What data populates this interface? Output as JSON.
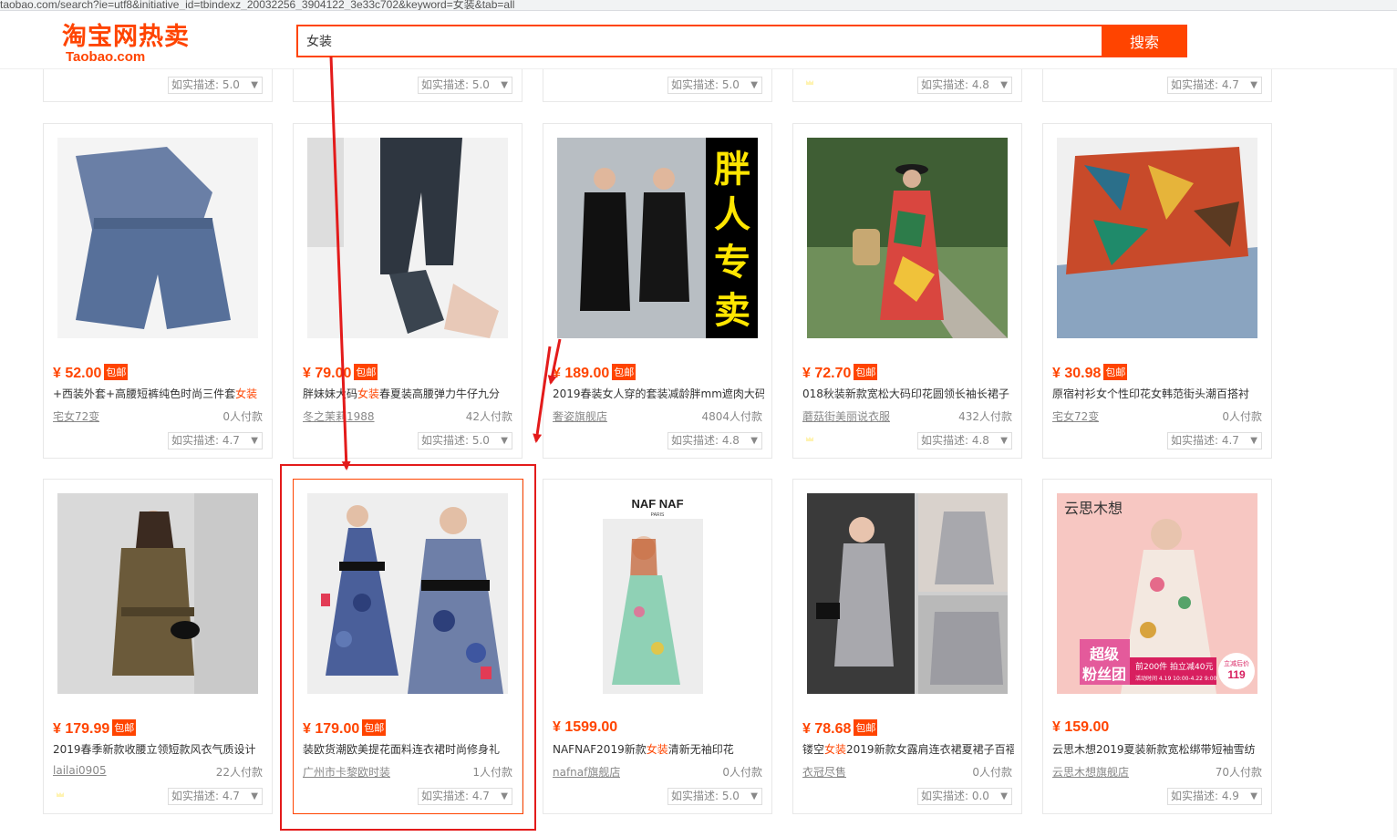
{
  "browser": {
    "url": "taobao.com/search?ie=utf8&initiative_id=tbindexz_20032256_3904122_3e33c702&keyword=女装&tab=all"
  },
  "header": {
    "logo_cn": "淘宝网热卖",
    "logo_en": "Taobao.com",
    "search_value": "女装",
    "search_button": "搜索",
    "accent_color": "#ff4400"
  },
  "rating_caret": "▼",
  "top_row": [
    {
      "icon": "tmall-icon",
      "rating": "如实描述: 5.0"
    },
    {
      "icon": "",
      "rating": "如实描述: 5.0"
    },
    {
      "icon": "",
      "rating": "如实描述: 5.0"
    },
    {
      "icon": "crown-icon",
      "rating": "如实描述: 4.8"
    },
    {
      "icon": "",
      "rating": "如实描述: 4.7"
    }
  ],
  "products": [
    {
      "price": "¥ 52.00",
      "badge": "包邮",
      "title_pre": "+西装外套+高腰短裤纯色时尚三件套",
      "title_kw": "女装",
      "title_post": "",
      "shop": "宅女72变",
      "sales": "0人付款",
      "icon": "",
      "rating": "如实描述: 4.7"
    },
    {
      "price": "¥ 79.00",
      "badge": "包邮",
      "title_pre": "胖妹妹大码",
      "title_kw": "女装",
      "title_post": "春夏装高腰弹力牛仔九分",
      "shop": "冬之茉莉1988",
      "sales": "42人付款",
      "icon": "",
      "rating": "如实描述: 5.0"
    },
    {
      "price": "¥ 189.00",
      "badge": "包邮",
      "title_pre": "2019春装女人穿的套装减龄胖mm遮肉大码",
      "title_kw": "",
      "title_post": "",
      "shop": "奢姿旗舰店",
      "sales": "4804人付款",
      "icon": "tmall-icon",
      "rating": "如实描述: 4.8"
    },
    {
      "price": "¥ 72.70",
      "badge": "包邮",
      "title_pre": "018秋装新款宽松大码印花圆领长袖长裙子",
      "title_kw": "",
      "title_post": "",
      "shop": "蘑菇街美丽说衣服",
      "sales": "432人付款",
      "icon": "crown-icon",
      "rating": "如实描述: 4.8"
    },
    {
      "price": "¥ 30.98",
      "badge": "包邮",
      "title_pre": "原宿衬衫女个性印花女韩范街头潮百搭衬",
      "title_kw": "",
      "title_post": "",
      "shop": "宅女72变",
      "sales": "0人付款",
      "icon": "",
      "rating": "如实描述: 4.7"
    },
    {
      "price": "¥ 179.99",
      "badge": "包邮",
      "title_pre": "2019春季新款收腰立领短款风衣气质设计",
      "title_kw": "",
      "title_post": "",
      "shop": "lailai0905",
      "sales": "22人付款",
      "icon": "crown-icon",
      "rating": "如实描述: 4.7"
    },
    {
      "price": "¥ 179.00",
      "badge": "包邮",
      "title_pre": "装欧货潮欧美提花面料连衣裙时尚修身礼",
      "title_kw": "",
      "title_post": "",
      "shop": "广州市卡黎欧时装",
      "sales": "1人付款",
      "icon": "",
      "rating": "如实描述: 4.7"
    },
    {
      "price": "¥ 1599.00",
      "badge": "",
      "title_pre": "NAFNAF2019新款",
      "title_kw": "女装",
      "title_post": "清新无袖印花",
      "shop": "nafnaf旗舰店",
      "sales": "0人付款",
      "icon": "tmall-icon",
      "rating": "如实描述: 5.0"
    },
    {
      "price": "¥ 78.68",
      "badge": "包邮",
      "title_pre": "镂空",
      "title_kw": "女装",
      "title_post": "2019新款女露肩连衣裙夏裙子百褶",
      "shop": "衣冠尽售",
      "sales": "0人付款",
      "icon": "",
      "rating": "如实描述: 0.0"
    },
    {
      "price": "¥ 159.00",
      "badge": "",
      "title_pre": "云思木想2019夏装新款宽松绑带短袖雪纺",
      "title_kw": "",
      "title_post": "",
      "shop": "云思木想旗舰店",
      "sales": "70人付款",
      "icon": "tmall-icon",
      "rating": "如实描述: 4.9"
    }
  ],
  "image_text": {
    "fat_promo": "胖人专卖",
    "nafnaf_logo": "NAF NAF",
    "nafnaf_sub": "PARIS",
    "yunsi_logo": "云思木想",
    "super_fans": "超级粉丝团",
    "promo_line": "前200件 拍立减40元",
    "promo_date": "活动时间 4.19 10:00-4.22 9:00",
    "promo_label": "立减后价",
    "promo_price": "119"
  },
  "colors": {
    "annotation_red": "#e31b1b",
    "price_orange": "#ff4400",
    "tmall_red": "#d0021b",
    "crown_gold": "#f5b400"
  }
}
